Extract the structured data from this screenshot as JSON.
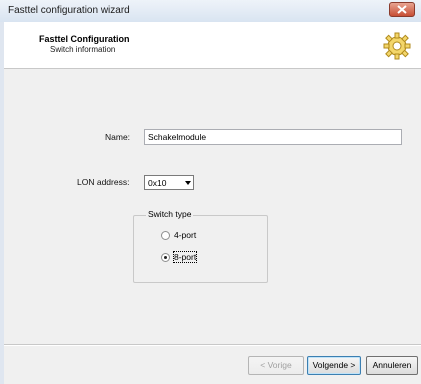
{
  "window": {
    "title": "Fasttel configuration wizard"
  },
  "header": {
    "title": "Fasttel Configuration",
    "subtitle": "Switch information",
    "icon": "gear-icon"
  },
  "form": {
    "name_label": "Name:",
    "name_value": "Schakelmodule",
    "lon_label": "LON address:",
    "lon_value": "0x10",
    "switch_type": {
      "legend": "Switch type",
      "options": [
        {
          "label": "4-port",
          "selected": false
        },
        {
          "label": "8-port",
          "selected": true
        }
      ]
    }
  },
  "buttons": {
    "back": "< Vorige",
    "next": "Volgende >",
    "cancel": "Annuleren"
  }
}
